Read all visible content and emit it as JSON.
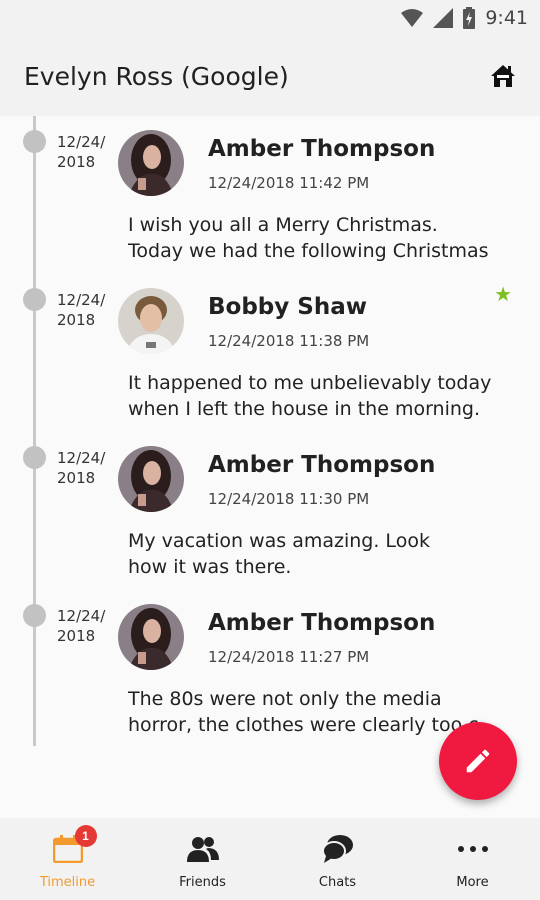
{
  "status_bar": {
    "time": "9:41"
  },
  "app_bar": {
    "title": "Evelyn Ross (Google)"
  },
  "posts": [
    {
      "date": "12/24/ 2018",
      "author": "Amber Thompson",
      "timestamp": "12/24/2018 11:42 PM",
      "text_line1": "I wish you all a Merry Christmas.",
      "text_line2": "Today we had the following Christmas",
      "starred": false
    },
    {
      "date": "12/24/ 2018",
      "author": "Bobby Shaw",
      "timestamp": "12/24/2018 11:38 PM",
      "text_line1": "It happened to me unbelievably today",
      "text_line2": "when I left the house in the morning.",
      "starred": true
    },
    {
      "date": "12/24/ 2018",
      "author": "Amber Thompson",
      "timestamp": "12/24/2018 11:30 PM",
      "text_line1": "My vacation was amazing. Look",
      "text_line2": "how it was there.",
      "starred": false
    },
    {
      "date": "12/24/ 2018",
      "author": "Amber Thompson",
      "timestamp": "12/24/2018 11:27 PM",
      "text_line1": "The 80s were not only the media",
      "text_line2": "horror, the clothes were clearly too c",
      "starred": false
    }
  ],
  "bottom_nav": {
    "items": [
      {
        "label": "Timeline",
        "icon": "calendar-icon",
        "badge": "1",
        "active": true
      },
      {
        "label": "Friends",
        "icon": "people-icon",
        "active": false
      },
      {
        "label": "Chats",
        "icon": "chat-bubbles-icon",
        "active": false
      },
      {
        "label": "More",
        "icon": "more-dots-icon",
        "active": false
      }
    ]
  },
  "colors": {
    "accent": "#f29a2e",
    "fab": "#f0193f",
    "star": "#7cbf20",
    "badge": "#e53935"
  }
}
